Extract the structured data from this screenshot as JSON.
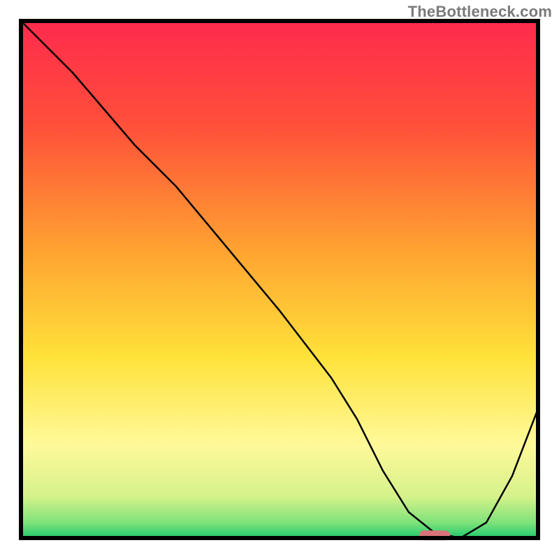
{
  "attribution": "TheBottleneck.com",
  "chart_data": {
    "type": "line",
    "title": "",
    "xlabel": "",
    "ylabel": "",
    "xlim": [
      0,
      100
    ],
    "ylim": [
      0,
      100
    ],
    "note": "Axes are unlabeled; x and y values are normalized 0–100 estimated from pixel positions.",
    "series": [
      {
        "name": "curve",
        "x": [
          0,
          10,
          22,
          30,
          40,
          50,
          60,
          65,
          70,
          75,
          80,
          85,
          90,
          95,
          100
        ],
        "y": [
          100,
          90,
          76,
          68,
          56,
          44,
          31,
          23,
          13,
          5,
          1,
          0,
          3,
          12,
          25
        ]
      }
    ],
    "marker": {
      "name": "highlight-pill",
      "x_center": 80,
      "y": 0.5,
      "color": "#d9737a",
      "width_pct": 6
    },
    "gradient_stops": [
      {
        "pct": 0,
        "color": "#ff2a4d"
      },
      {
        "pct": 20,
        "color": "#ff4f3a"
      },
      {
        "pct": 45,
        "color": "#ffa531"
      },
      {
        "pct": 65,
        "color": "#ffe23a"
      },
      {
        "pct": 82,
        "color": "#fff99a"
      },
      {
        "pct": 92,
        "color": "#d5f28a"
      },
      {
        "pct": 97,
        "color": "#7fe27a"
      },
      {
        "pct": 100,
        "color": "#1fc96d"
      }
    ]
  }
}
